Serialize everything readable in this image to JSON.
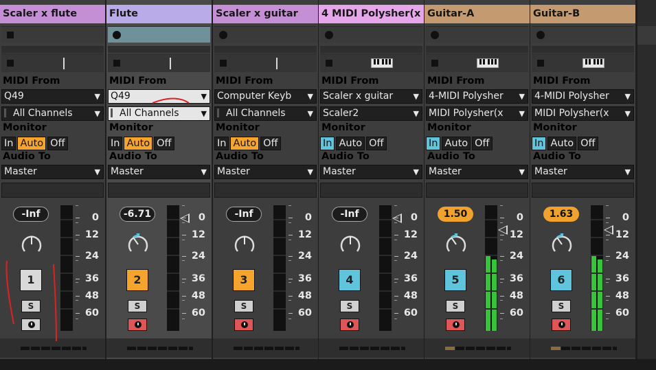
{
  "tracks": [
    {
      "name": "Scaler x flute",
      "color": "#c58fd6",
      "midi_from_label": "MIDI From",
      "midi_from": "Q49",
      "channel": "All Channels",
      "monitor_label": "Monitor",
      "monitor_options": [
        "In",
        "Auto",
        "Off"
      ],
      "monitor_active": "Auto",
      "audio_to_label": "Audio To",
      "audio_to": "Master",
      "volume": "-Inf",
      "number": "1",
      "solo": "S",
      "meter": 0
    },
    {
      "name": "Flute",
      "color": "#b8abe8",
      "midi_from_label": "MIDI From",
      "midi_from": "Q49",
      "channel": "All Channels",
      "monitor_label": "Monitor",
      "monitor_options": [
        "In",
        "Auto",
        "Off"
      ],
      "monitor_active": "Auto",
      "audio_to_label": "Audio To",
      "audio_to": "Master",
      "volume": "-6.71",
      "number": "2",
      "solo": "S",
      "meter": 0
    },
    {
      "name": "Scaler x guitar",
      "color": "#c58fd6",
      "midi_from_label": "MIDI From",
      "midi_from": "Computer Keyb",
      "channel": "All Channels",
      "monitor_label": "Monitor",
      "monitor_options": [
        "In",
        "Auto",
        "Off"
      ],
      "monitor_active": "Auto",
      "audio_to_label": "Audio To",
      "audio_to": "Master",
      "volume": "-Inf",
      "number": "3",
      "solo": "S",
      "meter": 0
    },
    {
      "name": "4 MIDI Polysher(x",
      "color": "#e6a6ea",
      "midi_from_label": "MIDI From",
      "midi_from": "Scaler x guitar",
      "channel": "Scaler2",
      "monitor_label": "Monitor",
      "monitor_options": [
        "In",
        "Auto",
        "Off"
      ],
      "monitor_active": "In",
      "audio_to_label": "Audio To",
      "audio_to": "Master",
      "volume": "-Inf",
      "number": "4",
      "solo": "S",
      "meter": 0
    },
    {
      "name": "Guitar-A",
      "color": "#c49a70",
      "midi_from_label": "MIDI From",
      "midi_from": "4-MIDI Polysher",
      "channel": "MIDI Polysher(x",
      "monitor_label": "Monitor",
      "monitor_options": [
        "In",
        "Auto",
        "Off"
      ],
      "monitor_active": "In",
      "audio_to_label": "Audio To",
      "audio_to": "Master",
      "volume": "1.50",
      "number": "5",
      "solo": "S",
      "meter": 0.6
    },
    {
      "name": "Guitar-B",
      "color": "#c49a70",
      "midi_from_label": "MIDI From",
      "midi_from": "4-MIDI Polysher",
      "channel": "MIDI Polysher(x",
      "monitor_label": "Monitor",
      "monitor_options": [
        "In",
        "Auto",
        "Off"
      ],
      "monitor_active": "In",
      "audio_to_label": "Audio To",
      "audio_to": "Master",
      "volume": "1.63",
      "number": "6",
      "solo": "S",
      "meter": 0.6
    }
  ],
  "meter_scale": [
    "0",
    "12",
    "24",
    "36",
    "48",
    "60"
  ]
}
